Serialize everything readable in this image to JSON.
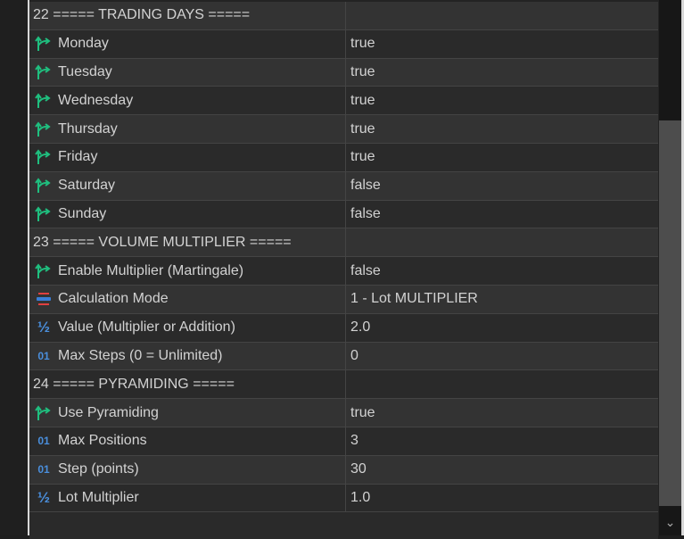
{
  "rows": [
    {
      "type": "header",
      "name": "22 ===== TRADING DAYS =====",
      "value": ""
    },
    {
      "type": "bool",
      "name": "Monday",
      "value": "true"
    },
    {
      "type": "bool",
      "name": "Tuesday",
      "value": "true"
    },
    {
      "type": "bool",
      "name": "Wednesday",
      "value": "true"
    },
    {
      "type": "bool",
      "name": "Thursday",
      "value": "true"
    },
    {
      "type": "bool",
      "name": "Friday",
      "value": "true"
    },
    {
      "type": "bool",
      "name": "Saturday",
      "value": "false"
    },
    {
      "type": "bool",
      "name": "Sunday",
      "value": "false"
    },
    {
      "type": "header",
      "name": "23 ===== VOLUME MULTIPLIER =====",
      "value": ""
    },
    {
      "type": "bool",
      "name": "Enable Multiplier (Martingale)",
      "value": "false"
    },
    {
      "type": "enum",
      "name": "Calculation Mode",
      "value": "1 - Lot MULTIPLIER"
    },
    {
      "type": "double",
      "name": "Value (Multiplier or Addition)",
      "value": "2.0"
    },
    {
      "type": "int",
      "name": "Max Steps (0 = Unlimited)",
      "value": "0"
    },
    {
      "type": "header",
      "name": "24 ===== PYRAMIDING =====",
      "value": ""
    },
    {
      "type": "bool",
      "name": "Use Pyramiding",
      "value": "true"
    },
    {
      "type": "int",
      "name": "Max Positions",
      "value": "3"
    },
    {
      "type": "int",
      "name": "Step (points)",
      "value": "30"
    },
    {
      "type": "double",
      "name": "Lot Multiplier",
      "value": "1.0"
    }
  ],
  "icons": {
    "bool": "bool-arrow-icon",
    "enum": "enum-list-icon",
    "double": "fraction-icon",
    "int": "integer-icon"
  },
  "scrollbar": {
    "position_fraction": 0.8
  }
}
